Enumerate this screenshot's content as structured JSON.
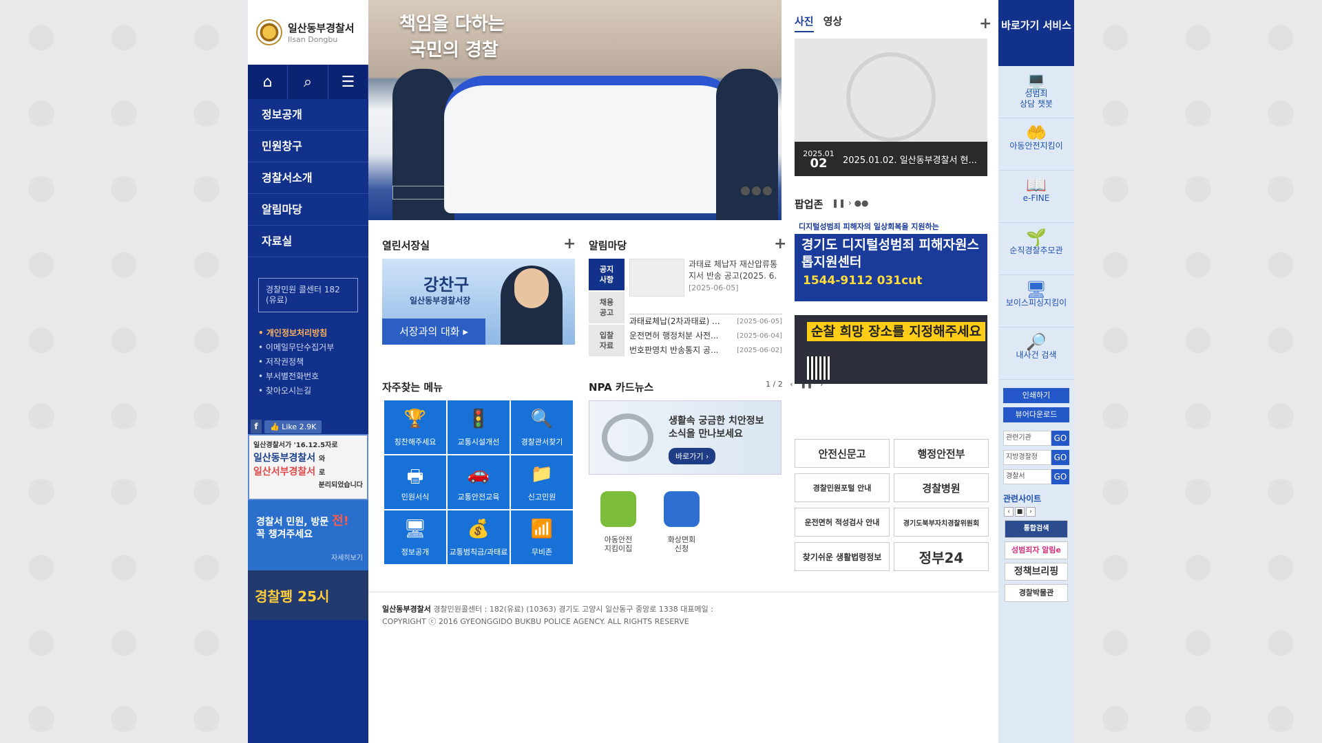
{
  "logo": {
    "name": "일산동부경찰서",
    "sub": "Ilsan Dongbu"
  },
  "tools": {
    "home": "⌂",
    "search": "⌕",
    "menu": "☰"
  },
  "menu": [
    "정보공개",
    "민원창구",
    "경찰서소개",
    "알림마당",
    "자료실"
  ],
  "callcenter": "경찰민원 콜센터 182 (유료)",
  "footer_links": [
    "개인정보처리방침",
    "이메일무단수집거부",
    "저작권정책",
    "부서별전화번호",
    "찾아오시는길"
  ],
  "facebook": {
    "label": "Like",
    "count": "2.9K"
  },
  "banner1": {
    "line1": "일산경찰서가 '16.12.5자로",
    "line2": "일산동부경찰서",
    "line3": "와",
    "line4": "일산서부경찰서",
    "line5": "로",
    "line6": "분리되었습니다"
  },
  "banner2": {
    "line1": "경찰서 민원, 방문",
    "red": "전!",
    "line2": "꼭 챙겨주세요",
    "more": "자세히보기"
  },
  "banner3": {
    "text": "경찰펭 25시"
  },
  "hero": {
    "line1": "책임을 다하는",
    "line2": "국민의 경찰"
  },
  "chief": {
    "section": "열린서장실",
    "name": "강찬구",
    "title": "일산동부경찰서장",
    "button": "서장과의 대화"
  },
  "notice": {
    "section": "알림마당",
    "tabs": [
      "공지\n사항",
      "채용\n공고",
      "입찰\n자료"
    ],
    "featured_title": "과태료 체납자 재산압류통지서 반송 공고(2025. 6.",
    "featured_date": "[2025-06-05]",
    "rows": [
      {
        "title": "과태료체납(2차과태료) ...",
        "date": "[2025-06-05]"
      },
      {
        "title": "운전면허 행정처분 사전...",
        "date": "[2025-06-04]"
      },
      {
        "title": "번호판영치 반송통지 공...",
        "date": "[2025-06-02]"
      }
    ]
  },
  "quickmenu": {
    "section": "자주찾는 메뉴",
    "pager": "1 / 2",
    "items": [
      {
        "label": "칭찬해주세요",
        "icon": "🏆"
      },
      {
        "label": "교통시설개선",
        "icon": "🚦"
      },
      {
        "label": "경찰관서찾기",
        "icon": "🔍"
      },
      {
        "label": "민원서식",
        "icon": "🖶"
      },
      {
        "label": "교통안전교육",
        "icon": "🚗"
      },
      {
        "label": "신고민원",
        "icon": "📁"
      },
      {
        "label": "정보공개",
        "icon": "🖥"
      },
      {
        "label": "교통범칙금/과태료",
        "icon": "💰"
      },
      {
        "label": "무비존",
        "icon": "📶"
      }
    ]
  },
  "cardnews": {
    "section": "NPA 카드뉴스",
    "line1": "생활속 궁금한 치안정보",
    "line2": "소식을 만나보세요",
    "button": "바로가기"
  },
  "apps": [
    {
      "label": "아동안전\n지킴이집",
      "color": "#7bbd3b"
    },
    {
      "label": "화상면회\n신청",
      "color": "#2f6fd1"
    }
  ],
  "photo": {
    "tab_photo": "사진",
    "tab_video": "영상",
    "date_ym": "2025.01",
    "date_d": "02",
    "caption": "2025.01.02. 일산동부경찰서 현..."
  },
  "popup": {
    "title": "팝업존",
    "pop1_top": "디지털성범죄 피해자의 일상회복을 지원하는",
    "pop1_main": "경기도 디지털성범죄 피해자원스톱지원센터",
    "pop1_tel": "1544-9112  031cut",
    "pop2_main": "순찰 희망 장소를 지정해주세요"
  },
  "orgs": [
    "안전신문고",
    "행정안전부",
    "경찰민원포털 안내",
    "경찰병원",
    "운전면허 적성검사 안내",
    "경기도북부자치경찰위원회",
    "찾기쉬운 생활법령정보",
    "정부24"
  ],
  "quick": {
    "header": "바로가기 서비스",
    "items": [
      {
        "label": "성범죄\n상담 챗봇",
        "icon": "💻"
      },
      {
        "label": "아동안전지킴이",
        "icon": "🤲"
      },
      {
        "label": "e-FINE",
        "icon": "📖"
      },
      {
        "label": "순직경찰추모관",
        "icon": "🌱"
      },
      {
        "label": "보이스피싱지킴이",
        "icon": "🖥"
      },
      {
        "label": "내사건 검색",
        "icon": "🔎"
      }
    ],
    "print": "인쇄하기",
    "viewer": "뷰어다운로드",
    "selects": [
      "관련기관",
      "지방경찰청",
      "경찰서"
    ],
    "go": "GO",
    "related": "관련사이트",
    "related_items": [
      "통합검색",
      "성범죄자 알림e",
      "정책브리핑",
      "경찰박물관"
    ]
  },
  "footer": {
    "name": "일산동부경찰서",
    "info": " 경찰민원콜센터 : 182(유료) (10363) 경기도 고양시 일산동구 중앙로 1338    대표메일 :",
    "copy": "COPYRIGHT ⓒ 2016 GYEONGGIDO BUKBU POLICE AGENCY. ALL RIGHTS RESERVE"
  },
  "colors": {
    "navy": "#12318a",
    "blue": "#1771d6",
    "orange": "#ffb25e"
  }
}
